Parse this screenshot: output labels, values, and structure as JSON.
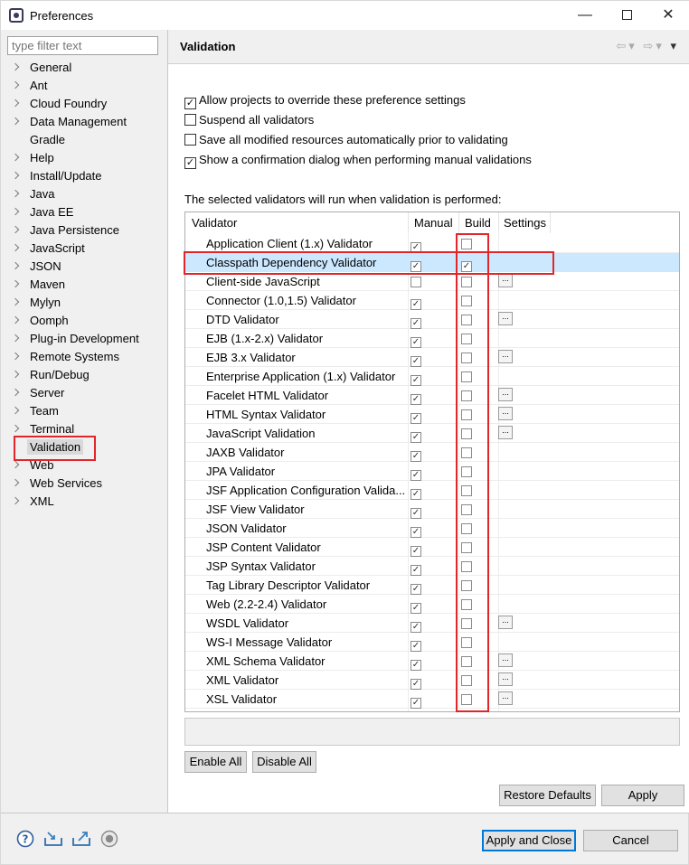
{
  "window": {
    "title": "Preferences",
    "minimize_glyph": "—",
    "close_glyph": "✕"
  },
  "filter": {
    "placeholder": "type filter text"
  },
  "tree": [
    {
      "label": "General",
      "expandable": true
    },
    {
      "label": "Ant",
      "expandable": true
    },
    {
      "label": "Cloud Foundry",
      "expandable": true
    },
    {
      "label": "Data Management",
      "expandable": true
    },
    {
      "label": "Gradle",
      "expandable": false
    },
    {
      "label": "Help",
      "expandable": true
    },
    {
      "label": "Install/Update",
      "expandable": true
    },
    {
      "label": "Java",
      "expandable": true
    },
    {
      "label": "Java EE",
      "expandable": true
    },
    {
      "label": "Java Persistence",
      "expandable": true
    },
    {
      "label": "JavaScript",
      "expandable": true
    },
    {
      "label": "JSON",
      "expandable": true
    },
    {
      "label": "Maven",
      "expandable": true
    },
    {
      "label": "Mylyn",
      "expandable": true
    },
    {
      "label": "Oomph",
      "expandable": true
    },
    {
      "label": "Plug-in Development",
      "expandable": true
    },
    {
      "label": "Remote Systems",
      "expandable": true
    },
    {
      "label": "Run/Debug",
      "expandable": true
    },
    {
      "label": "Server",
      "expandable": true
    },
    {
      "label": "Team",
      "expandable": true
    },
    {
      "label": "Terminal",
      "expandable": true
    },
    {
      "label": "Validation",
      "expandable": false,
      "selected": true
    },
    {
      "label": "Web",
      "expandable": true
    },
    {
      "label": "Web Services",
      "expandable": true
    },
    {
      "label": "XML",
      "expandable": true
    }
  ],
  "page": {
    "title": "Validation"
  },
  "options": [
    {
      "label": "Allow projects to override these preference settings",
      "checked": true
    },
    {
      "label": "Suspend all validators",
      "checked": false
    },
    {
      "label": "Save all modified resources automatically prior to validating",
      "checked": false
    },
    {
      "label": "Show a confirmation dialog when performing manual validations",
      "checked": true
    }
  ],
  "table_caption": "The selected validators will run when validation is performed:",
  "table": {
    "headers": {
      "validator": "Validator",
      "manual": "Manual",
      "build": "Build",
      "settings": "Settings"
    },
    "settings_glyph": "...",
    "check_glyph": "✓",
    "rows": [
      {
        "name": "Application Client (1.x) Validator",
        "manual": true,
        "build": false,
        "settings": false
      },
      {
        "name": "Classpath Dependency Validator",
        "manual": true,
        "build": true,
        "settings": false,
        "selected": true
      },
      {
        "name": "Client-side JavaScript",
        "manual": false,
        "build": false,
        "settings": true
      },
      {
        "name": "Connector (1.0,1.5) Validator",
        "manual": true,
        "build": false,
        "settings": false
      },
      {
        "name": "DTD Validator",
        "manual": true,
        "build": false,
        "settings": true
      },
      {
        "name": "EJB (1.x-2.x) Validator",
        "manual": true,
        "build": false,
        "settings": false
      },
      {
        "name": "EJB 3.x Validator",
        "manual": true,
        "build": false,
        "settings": true
      },
      {
        "name": "Enterprise Application (1.x) Validator",
        "manual": true,
        "build": false,
        "settings": false
      },
      {
        "name": "Facelet HTML Validator",
        "manual": true,
        "build": false,
        "settings": true
      },
      {
        "name": "HTML Syntax Validator",
        "manual": true,
        "build": false,
        "settings": true
      },
      {
        "name": "JavaScript Validation",
        "manual": true,
        "build": false,
        "settings": true
      },
      {
        "name": "JAXB Validator",
        "manual": true,
        "build": false,
        "settings": false
      },
      {
        "name": "JPA Validator",
        "manual": true,
        "build": false,
        "settings": false
      },
      {
        "name": "JSF Application Configuration Valida...",
        "manual": true,
        "build": false,
        "settings": false
      },
      {
        "name": "JSF View Validator",
        "manual": true,
        "build": false,
        "settings": false
      },
      {
        "name": "JSON Validator",
        "manual": true,
        "build": false,
        "settings": false
      },
      {
        "name": "JSP Content Validator",
        "manual": true,
        "build": false,
        "settings": false
      },
      {
        "name": "JSP Syntax Validator",
        "manual": true,
        "build": false,
        "settings": false
      },
      {
        "name": "Tag Library Descriptor Validator",
        "manual": true,
        "build": false,
        "settings": false
      },
      {
        "name": "Web (2.2-2.4) Validator",
        "manual": true,
        "build": false,
        "settings": false
      },
      {
        "name": "WSDL Validator",
        "manual": true,
        "build": false,
        "settings": true
      },
      {
        "name": "WS-I Message Validator",
        "manual": true,
        "build": false,
        "settings": false
      },
      {
        "name": "XML Schema Validator",
        "manual": true,
        "build": false,
        "settings": true
      },
      {
        "name": "XML Validator",
        "manual": true,
        "build": false,
        "settings": true
      },
      {
        "name": "XSL Validator",
        "manual": true,
        "build": false,
        "settings": true
      }
    ]
  },
  "buttons": {
    "enable_all": "Enable All",
    "disable_all": "Disable All",
    "restore_defaults": "Restore Defaults",
    "apply": "Apply",
    "apply_and_close": "Apply and Close",
    "cancel": "Cancel"
  },
  "bottom_icons": [
    "help-icon",
    "import-icon",
    "export-icon",
    "record-icon"
  ],
  "colors": {
    "highlight": "#e0262a",
    "selection": "#cce8ff",
    "default_button_border": "#0078d7"
  }
}
